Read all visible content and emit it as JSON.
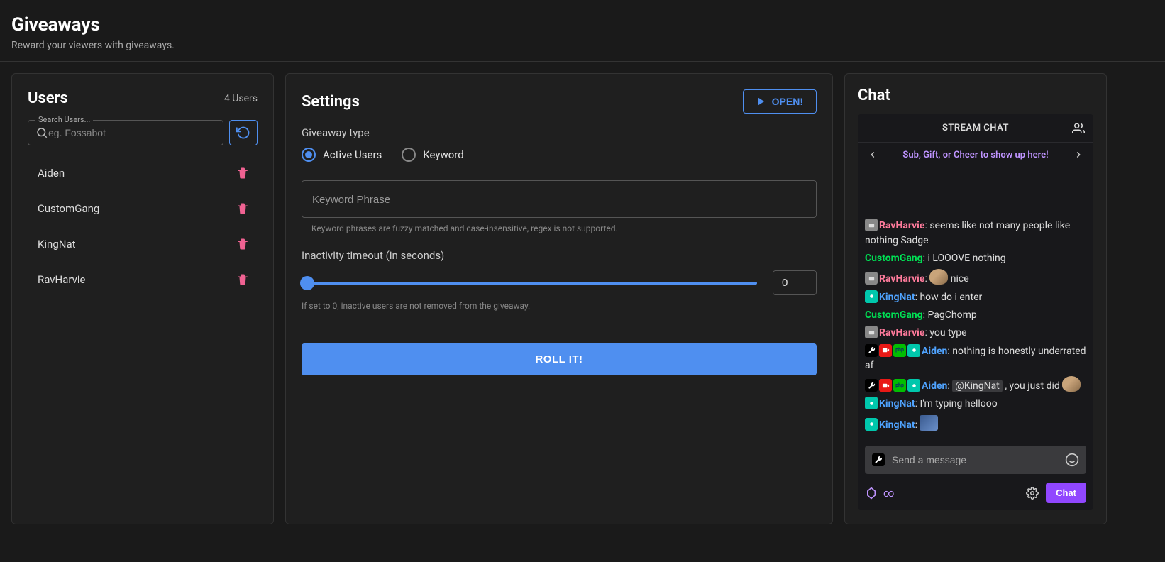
{
  "header": {
    "title": "Giveaways",
    "subtitle": "Reward your viewers with giveaways."
  },
  "users_panel": {
    "title": "Users",
    "count_label": "4 Users",
    "search_label": "Search Users...",
    "search_placeholder": "eg. Fossabot",
    "items": [
      {
        "name": "Aiden"
      },
      {
        "name": "CustomGang"
      },
      {
        "name": "KingNat"
      },
      {
        "name": "RavHarvie"
      }
    ]
  },
  "settings_panel": {
    "title": "Settings",
    "open_label": "OPEN!",
    "giveaway_type_label": "Giveaway type",
    "radio_active": "Active Users",
    "radio_keyword": "Keyword",
    "selected_radio": "active",
    "keyword_placeholder": "Keyword Phrase",
    "keyword_help": "Keyword phrases are fuzzy matched and case-insensitive, regex is not supported.",
    "inactivity_label": "Inactivity timeout (in seconds)",
    "inactivity_value": "0",
    "inactivity_help": "If set to 0, inactive users are not removed from the giveaway.",
    "roll_label": "ROLL IT!"
  },
  "chat_panel": {
    "title": "Chat",
    "stream_chat_label": "STREAM CHAT",
    "banner": "Sub, Gift, or Cheer to show up here!",
    "input_placeholder": "Send a message",
    "points": "∞",
    "send_label": "Chat",
    "user_colors": {
      "RavHarvie": "#ff7b9c",
      "CustomGang": "#00e054",
      "KingNat": "#4fa3ff",
      "Aiden": "#4fa3ff"
    },
    "messages": [
      {
        "user": "RavHarvie",
        "badges": [
          "gray"
        ],
        "text": "seems like not many people like nothing Sadge"
      },
      {
        "user": "CustomGang",
        "badges": [],
        "text": "i LOOOVE nothing"
      },
      {
        "user": "RavHarvie",
        "badges": [
          "gray"
        ],
        "text": "nice",
        "pre_emote": "face"
      },
      {
        "user": "KingNat",
        "badges": [
          "teal"
        ],
        "text": "how do i enter"
      },
      {
        "user": "CustomGang",
        "badges": [],
        "text": "PagChomp"
      },
      {
        "user": "RavHarvie",
        "badges": [
          "gray"
        ],
        "text": "you type"
      },
      {
        "user": "Aiden",
        "badges": [
          "wrench",
          "cam",
          "php",
          "teal"
        ],
        "text": "nothing is honestly underrated af"
      },
      {
        "user": "Aiden",
        "badges": [
          "wrench",
          "cam",
          "php",
          "teal"
        ],
        "mention": "@KingNat",
        "text": ", you just did",
        "post_emote": "face"
      },
      {
        "user": "KingNat",
        "badges": [
          "teal"
        ],
        "text": "I'm typing hellooo"
      },
      {
        "user": "KingNat",
        "badges": [
          "teal"
        ],
        "text": "",
        "post_emote": "shark"
      }
    ]
  }
}
